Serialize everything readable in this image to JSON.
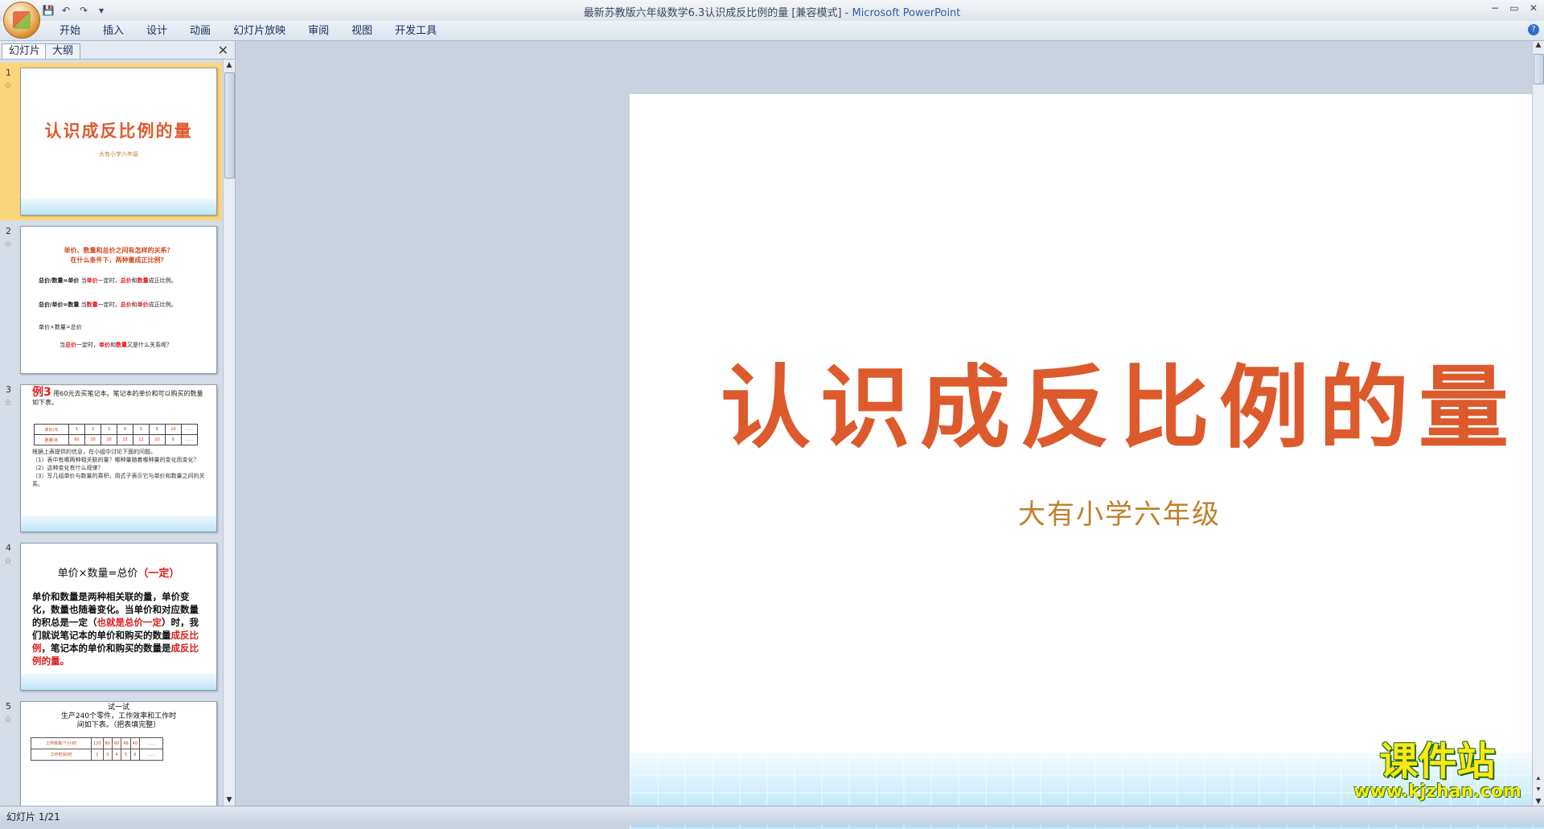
{
  "window": {
    "title": "最新苏教版六年级数学6.3认识成反比例的量 [兼容模式]",
    "separator": " - ",
    "app_name": "Microsoft PowerPoint"
  },
  "qat": {
    "save_icon": "💾",
    "undo_icon": "↶",
    "redo_icon": "↷",
    "more_icon": "▾"
  },
  "window_controls": {
    "minimize": "−",
    "restore": "▭",
    "close": "✕"
  },
  "ribbon": {
    "tabs": [
      "开始",
      "插入",
      "设计",
      "动画",
      "幻灯片放映",
      "审阅",
      "视图",
      "开发工具"
    ],
    "help_icon": "?"
  },
  "pane": {
    "tabs": [
      "幻灯片",
      "大纲"
    ],
    "close_icon": "✕"
  },
  "thumbnails": [
    {
      "number": "1",
      "title": "认识成反比例的量",
      "subtitle": "大有小学六年级"
    },
    {
      "number": "2",
      "heading_line1": "单价、数量和总价之间有怎样的关系？",
      "heading_line2": "在什么条件下，两种量成正比例？",
      "line1_formula": "总价/数量=单价",
      "line1_text_a": "当",
      "line1_red_a": "单价",
      "line1_text_b": "一定时，",
      "line1_red_b": "总价",
      "line1_text_c": "和",
      "line1_red_c": "数量",
      "line1_text_d": "成正比例。",
      "line2_formula": "总价/单价=数量",
      "line2_text_a": "当",
      "line2_red_a": "数量",
      "line2_text_b": "一定时，",
      "line2_red_b": "总价",
      "line2_text_c": "和",
      "line2_red_c": "单价",
      "line2_text_d": "成正比例。",
      "line3": "单价×数量=总价",
      "line4_text_a": "当",
      "line4_red_a": "总价",
      "line4_text_b": "一定时，",
      "line4_red_b": "单价",
      "line4_text_c": "和",
      "line4_red_c": "数量",
      "line4_text_d": "又是什么关系呢？"
    },
    {
      "number": "3",
      "example_label": "例3",
      "intro": "用60元去买笔记本。笔记本的单价和可以购买的数量如下表。",
      "table_row1": [
        "单价/元",
        "1",
        "2",
        "3",
        "4",
        "5",
        "6",
        "10",
        "……"
      ],
      "table_row2": [
        "数量/本",
        "60",
        "30",
        "20",
        "15",
        "12",
        "10",
        "6",
        "……"
      ],
      "q0": "根据上表提供的信息，在小组中讨论下面的问题。",
      "q1": "（1）表中有哪两种相关联的量？哪种量随着哪种量的变化而变化？",
      "q2": "（2）这种变化有什么规律？",
      "q3": "（3）写几组单价与数量的乘积，用式子表示它与单价和数量之间的关系。"
    },
    {
      "number": "4",
      "heading": "单价×数量=总价",
      "heading_red": "（一定）",
      "body_a": "单价和数量是两种相关联的量，单价变化，数量也随着变化。当单价和对应数量的积总是一定（",
      "body_red_a": "也就是总价一定",
      "body_b": "）时，我们就说笔记本的单价和购买的数量",
      "body_red_b": "成反比例",
      "body_c": "，笔记本的单价和购买的数量是",
      "body_red_c": "成反比例的量。"
    },
    {
      "number": "5",
      "title": "试一试",
      "line1": "生产240个零件，工作效率和工作时",
      "line2": "间如下表。（把表填完整）",
      "table_row1": [
        "工作效率/个/小时",
        "120",
        "80",
        "60",
        "48",
        "40",
        "……"
      ],
      "table_row2": [
        "工作时间/时",
        "2",
        "3",
        "4",
        "5",
        "6",
        "……"
      ]
    }
  ],
  "main_slide": {
    "title": "认识成反比例的量",
    "subtitle": "大有小学六年级"
  },
  "status": {
    "slide_counter": "幻灯片 1/21"
  },
  "watermark": {
    "main": "课件站",
    "url": "www.kjzhan.com"
  }
}
